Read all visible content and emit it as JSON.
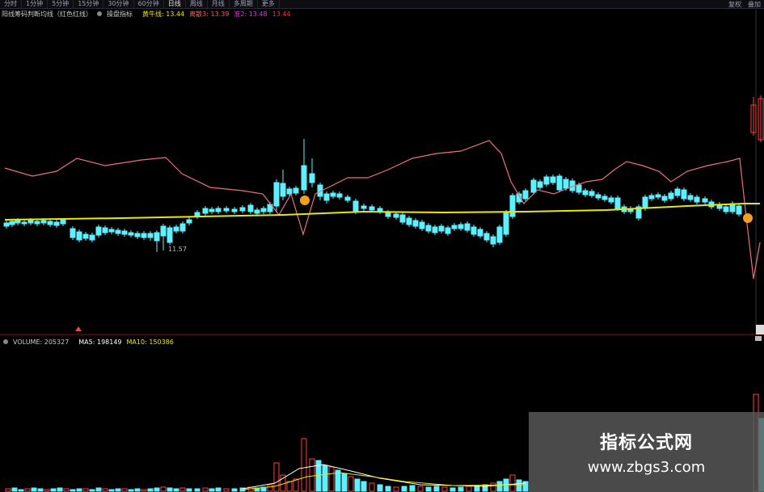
{
  "tabs": {
    "items": [
      "分时",
      "1分钟",
      "5分钟",
      "15分钟",
      "30分钟",
      "60分钟",
      "日线",
      "周线",
      "月线",
      "多周期",
      "更多"
    ],
    "active_index": 6,
    "right_items": [
      "复权",
      "叠加"
    ]
  },
  "indicator_legend": {
    "name": "阳线筹码判断均线（红色红线）",
    "sub": "操盘指标",
    "items": [
      {
        "label": "黄牛线: 13.44",
        "color": "#e8e800"
      },
      {
        "label": "离散3: 13.39",
        "color": "#ff5a5a"
      },
      {
        "label": "准2: 13.48",
        "color": "#cc44cc"
      },
      {
        "label": "13.44",
        "color": "#ff3030"
      }
    ]
  },
  "low_label": "11.57",
  "volume_legend": {
    "name": "VOLUME: 205327",
    "ma5": "MA5: 198149",
    "ma10": "MA10: 150386",
    "ma5_color": "#ffffff",
    "ma10_color": "#e8e800"
  },
  "watermark": {
    "title": "指标公式网",
    "url": "www.zbgs3.com"
  },
  "colors": {
    "up": "#ff4040",
    "down": "#5ff0ff",
    "pink_line": "#e8707a",
    "yellow_line": "#e8e800",
    "marker": "#f0a020"
  }
}
